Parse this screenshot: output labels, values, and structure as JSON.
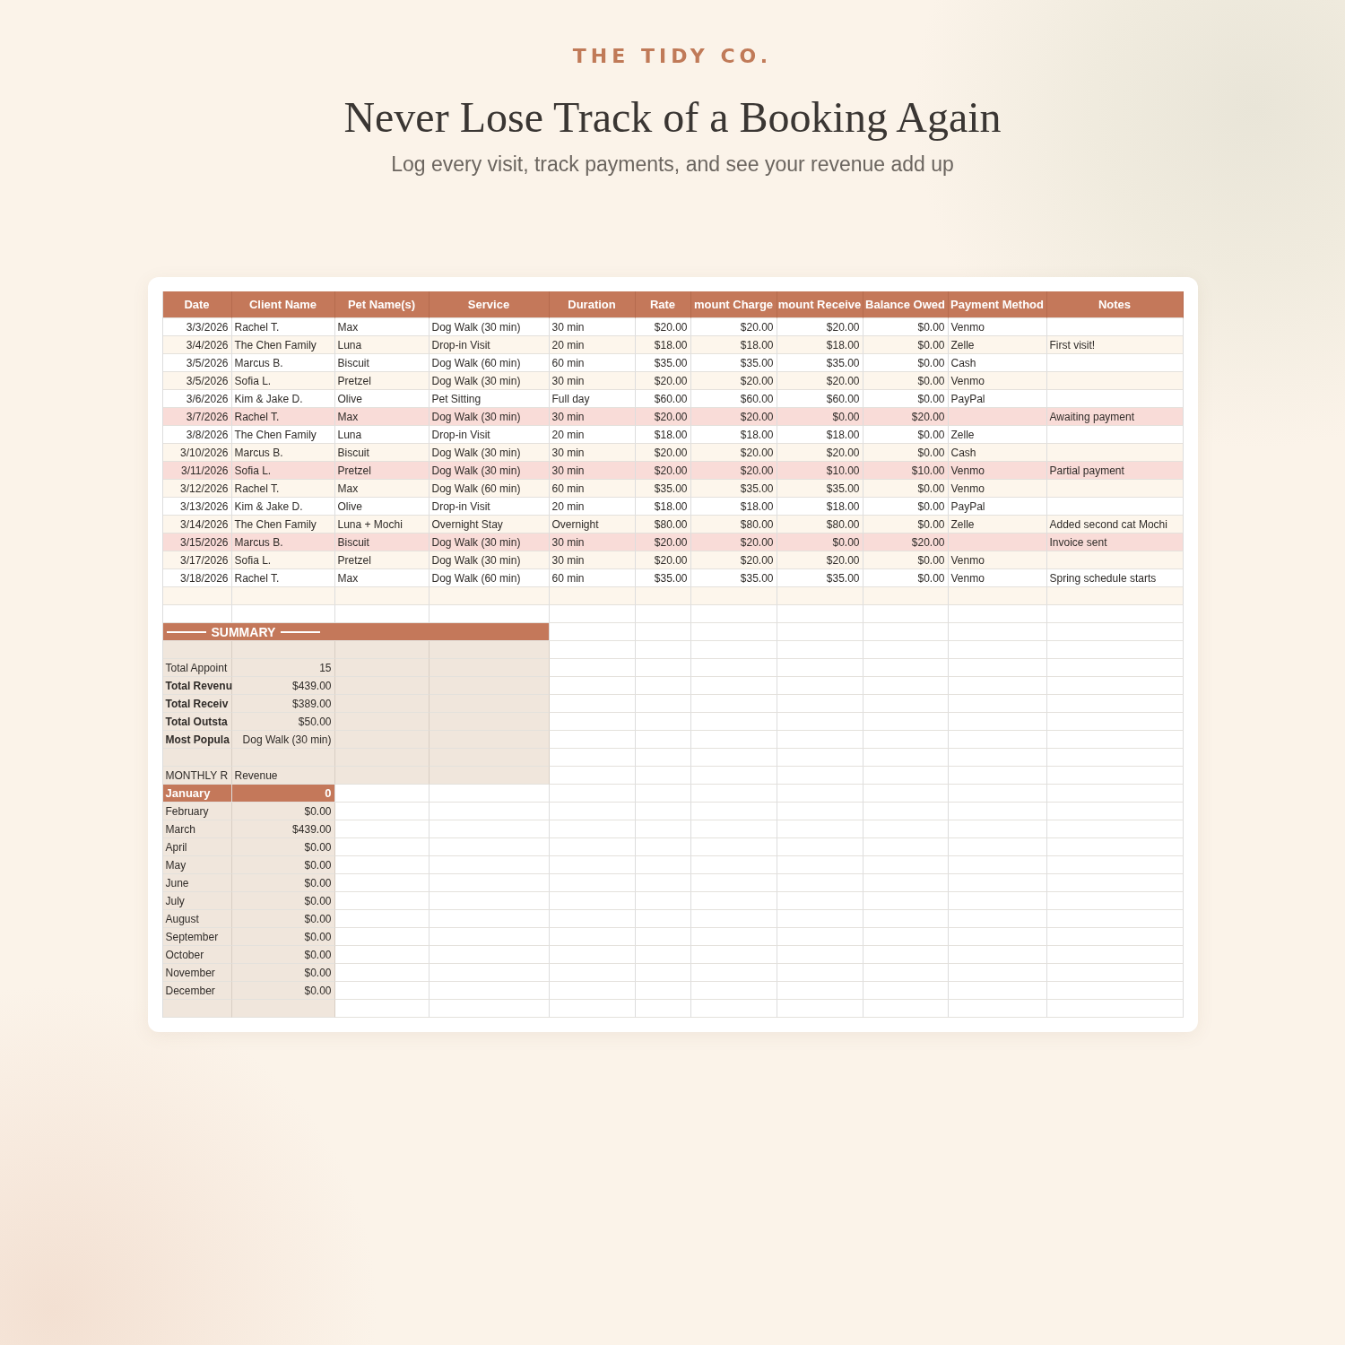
{
  "brand": "THE TIDY CO.",
  "title": "Never Lose Track of a Booking Again",
  "subtitle": "Log every visit, track payments, and see your revenue add up",
  "table": {
    "columns": [
      "Date",
      "Client Name",
      "Pet Name(s)",
      "Service",
      "Duration",
      "Rate",
      "mount Charge",
      "mount Receive",
      "Balance Owed",
      "Payment Method",
      "Notes"
    ],
    "rows": [
      {
        "highlighted": false,
        "cells": [
          "3/3/2026",
          "Rachel T.",
          "Max",
          "Dog Walk (30 min)",
          "30 min",
          "$20.00",
          "$20.00",
          "$20.00",
          "$0.00",
          "Venmo",
          ""
        ]
      },
      {
        "highlighted": false,
        "cells": [
          "3/4/2026",
          "The Chen Family",
          "Luna",
          "Drop-in Visit",
          "20 min",
          "$18.00",
          "$18.00",
          "$18.00",
          "$0.00",
          "Zelle",
          "First visit!"
        ]
      },
      {
        "highlighted": false,
        "cells": [
          "3/5/2026",
          "Marcus B.",
          "Biscuit",
          "Dog Walk (60 min)",
          "60 min",
          "$35.00",
          "$35.00",
          "$35.00",
          "$0.00",
          "Cash",
          ""
        ]
      },
      {
        "highlighted": false,
        "cells": [
          "3/5/2026",
          "Sofia L.",
          "Pretzel",
          "Dog Walk (30 min)",
          "30 min",
          "$20.00",
          "$20.00",
          "$20.00",
          "$0.00",
          "Venmo",
          ""
        ]
      },
      {
        "highlighted": false,
        "cells": [
          "3/6/2026",
          "Kim & Jake D.",
          "Olive",
          "Pet Sitting",
          "Full day",
          "$60.00",
          "$60.00",
          "$60.00",
          "$0.00",
          "PayPal",
          ""
        ]
      },
      {
        "highlighted": true,
        "cells": [
          "3/7/2026",
          "Rachel T.",
          "Max",
          "Dog Walk (30 min)",
          "30 min",
          "$20.00",
          "$20.00",
          "$0.00",
          "$20.00",
          "",
          "Awaiting payment"
        ]
      },
      {
        "highlighted": false,
        "cells": [
          "3/8/2026",
          "The Chen Family",
          "Luna",
          "Drop-in Visit",
          "20 min",
          "$18.00",
          "$18.00",
          "$18.00",
          "$0.00",
          "Zelle",
          ""
        ]
      },
      {
        "highlighted": false,
        "cells": [
          "3/10/2026",
          "Marcus B.",
          "Biscuit",
          "Dog Walk (30 min)",
          "30 min",
          "$20.00",
          "$20.00",
          "$20.00",
          "$0.00",
          "Cash",
          ""
        ]
      },
      {
        "highlighted": true,
        "cells": [
          "3/11/2026",
          "Sofia L.",
          "Pretzel",
          "Dog Walk (30 min)",
          "30 min",
          "$20.00",
          "$20.00",
          "$10.00",
          "$10.00",
          "Venmo",
          "Partial payment"
        ]
      },
      {
        "highlighted": false,
        "cells": [
          "3/12/2026",
          "Rachel T.",
          "Max",
          "Dog Walk (60 min)",
          "60 min",
          "$35.00",
          "$35.00",
          "$35.00",
          "$0.00",
          "Venmo",
          ""
        ]
      },
      {
        "highlighted": false,
        "cells": [
          "3/13/2026",
          "Kim & Jake D.",
          "Olive",
          "Drop-in Visit",
          "20 min",
          "$18.00",
          "$18.00",
          "$18.00",
          "$0.00",
          "PayPal",
          ""
        ]
      },
      {
        "highlighted": false,
        "cells": [
          "3/14/2026",
          "The Chen Family",
          "Luna + Mochi",
          "Overnight Stay",
          "Overnight",
          "$80.00",
          "$80.00",
          "$80.00",
          "$0.00",
          "Zelle",
          "Added second cat Mochi"
        ]
      },
      {
        "highlighted": true,
        "cells": [
          "3/15/2026",
          "Marcus B.",
          "Biscuit",
          "Dog Walk (30 min)",
          "30 min",
          "$20.00",
          "$20.00",
          "$0.00",
          "$20.00",
          "",
          "Invoice sent"
        ]
      },
      {
        "highlighted": false,
        "cells": [
          "3/17/2026",
          "Sofia L.",
          "Pretzel",
          "Dog Walk (30 min)",
          "30 min",
          "$20.00",
          "$20.00",
          "$20.00",
          "$0.00",
          "Venmo",
          ""
        ]
      },
      {
        "highlighted": false,
        "cells": [
          "3/18/2026",
          "Rachel T.",
          "Max",
          "Dog Walk (60 min)",
          "60 min",
          "$35.00",
          "$35.00",
          "$35.00",
          "$0.00",
          "Venmo",
          "Spring schedule starts"
        ]
      }
    ]
  },
  "summary": {
    "title": "SUMMARY",
    "stats": [
      {
        "label": "Total Appoint",
        "value": "15",
        "bold": false
      },
      {
        "label": "Total Revenu",
        "value": "$439.00",
        "bold": true
      },
      {
        "label": "Total Receiv",
        "value": "$389.00",
        "bold": true
      },
      {
        "label": "Total Outsta",
        "value": "$50.00",
        "bold": true
      },
      {
        "label": "Most Popula",
        "value": "Dog Walk (30 min)",
        "bold": true
      }
    ],
    "monthly": {
      "label": "MONTHLY R",
      "value_header": "Revenue",
      "months": [
        {
          "month": "January",
          "value": "0",
          "highlighted": true
        },
        {
          "month": "February",
          "value": "$0.00",
          "highlighted": false
        },
        {
          "month": "March",
          "value": "$439.00",
          "highlighted": false
        },
        {
          "month": "April",
          "value": "$0.00",
          "highlighted": false
        },
        {
          "month": "May",
          "value": "$0.00",
          "highlighted": false
        },
        {
          "month": "June",
          "value": "$0.00",
          "highlighted": false
        },
        {
          "month": "July",
          "value": "$0.00",
          "highlighted": false
        },
        {
          "month": "August",
          "value": "$0.00",
          "highlighted": false
        },
        {
          "month": "September",
          "value": "$0.00",
          "highlighted": false
        },
        {
          "month": "October",
          "value": "$0.00",
          "highlighted": false
        },
        {
          "month": "November",
          "value": "$0.00",
          "highlighted": false
        },
        {
          "month": "December",
          "value": "$0.00",
          "highlighted": false
        }
      ]
    }
  }
}
